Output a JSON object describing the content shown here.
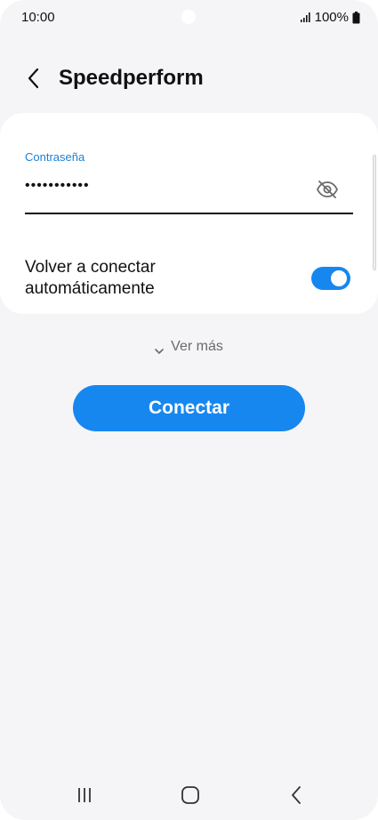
{
  "status_bar": {
    "time": "10:00",
    "battery_text": "100%",
    "signal_icon": "signal-icon",
    "battery_icon": "battery-icon"
  },
  "header": {
    "back_icon": "back-arrow-icon",
    "title": "Speedperform"
  },
  "password_field": {
    "label": "Contraseña",
    "value": "•••••••••••",
    "visibility_icon": "eye-slash-icon"
  },
  "auto_reconnect": {
    "label": "Volver a conectar automáticamente",
    "enabled": true
  },
  "see_more": {
    "label": "Ver más",
    "icon": "chevron-down-icon"
  },
  "connect_button": {
    "label": "Conectar"
  },
  "nav_bar": {
    "recents_icon": "recents-icon",
    "home_icon": "home-icon",
    "back_icon": "back-icon"
  },
  "colors": {
    "accent": "#1787f0",
    "label_blue": "#1e7fd1",
    "background": "#f5f5f7",
    "card": "#ffffff"
  }
}
